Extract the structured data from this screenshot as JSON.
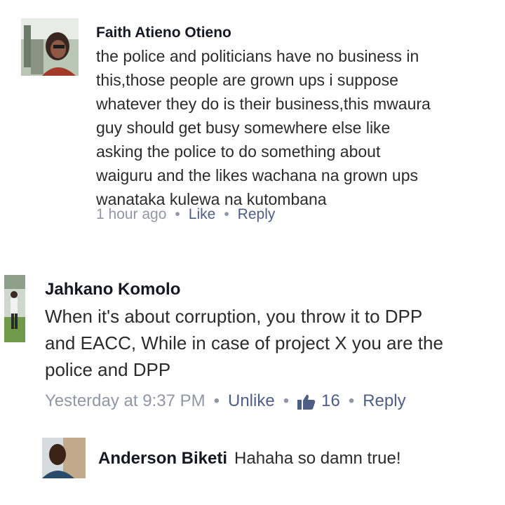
{
  "comments": [
    {
      "author": "Faith Atieno Otieno",
      "text": "the police and politicians have no business in\nthis,those people are grown ups i suppose\nwhatever they do is their business,this mwaura\nguy should get busy somewhere else like\nasking the police to do something about\nwaiguru and the likes wachana na grown ups\nwanataka kulewa na kutombana",
      "time": "1 hour ago",
      "like_label": "Like",
      "reply_label": "Reply"
    },
    {
      "author": "Jahkano Komolo",
      "text": "When it's about corruption, you throw it to DPP\nand EACC, While in case of project X you are the\npolice and DPP",
      "time": "Yesterday at 9:37 PM",
      "like_label": "Unlike",
      "like_count": "16",
      "reply_label": "Reply"
    }
  ],
  "reply": {
    "author": "Anderson Biketi",
    "text": "Hahaha so damn true!"
  },
  "colors": {
    "link": "#4e5e85",
    "meta": "#9197a3",
    "name": "#141823"
  },
  "icons": {
    "like_count_icon": "thumbs-up-icon"
  }
}
